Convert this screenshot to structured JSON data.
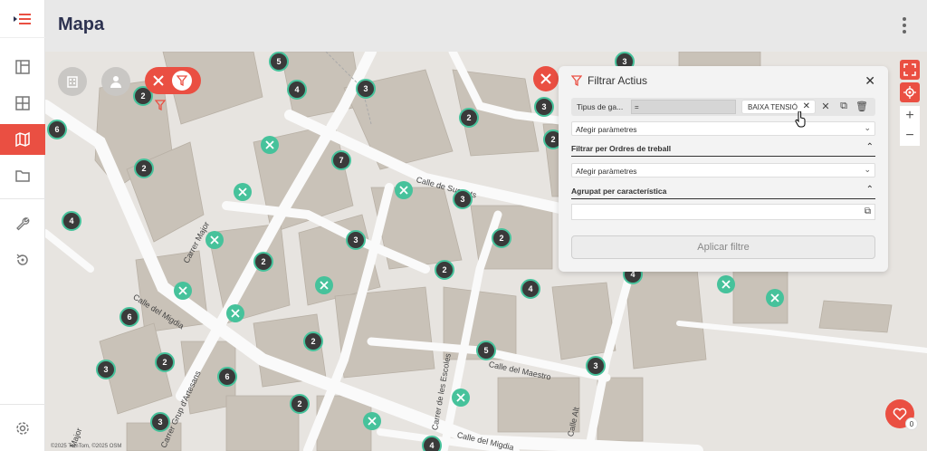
{
  "header": {
    "title": "Mapa"
  },
  "sidebar": {
    "items": [
      {
        "name": "menu-toggle"
      },
      {
        "name": "dashboard"
      },
      {
        "name": "grid"
      },
      {
        "name": "map",
        "active": true
      },
      {
        "name": "folder"
      },
      {
        "name": "tools"
      },
      {
        "name": "history"
      },
      {
        "name": "settings"
      }
    ]
  },
  "map": {
    "streets": [
      "Calle de Suguets",
      "Carrer Major",
      "Calle del Migdia",
      "Calle del Maestro",
      "Carrer de les Escoles",
      "Carrer Grup d'Artesans",
      "Calle del Migdia",
      "Calle Alt",
      "Major"
    ],
    "attribution": "©2025 TomTom, ©2025 OSM",
    "clusters": [
      "5",
      "4",
      "3",
      "3",
      "2",
      "6",
      "2",
      "7",
      "2",
      "3",
      "2",
      "2",
      "2",
      "2",
      "3",
      "4",
      "6",
      "4",
      "2",
      "4",
      "2",
      "3",
      "3",
      "6",
      "2",
      "3",
      "5",
      "4",
      "3",
      "2"
    ]
  },
  "filter_panel": {
    "title": "Filtrar Actius",
    "row": {
      "label": "Tipus de ga...",
      "operator": "=",
      "chip": "BAIXA TENSIÓ"
    },
    "add_params_1": "Afegir paràmetres",
    "section_orders": "Filtrar per Ordres de treball",
    "add_params_2": "Afegir paràmetres",
    "section_grouped": "Agrupat per característica",
    "apply_label": "Aplicar filtre"
  },
  "favorites": {
    "count": "0"
  },
  "colors": {
    "accent": "#ea4f42",
    "marker_green": "#46c29b",
    "title": "#2d3250"
  }
}
